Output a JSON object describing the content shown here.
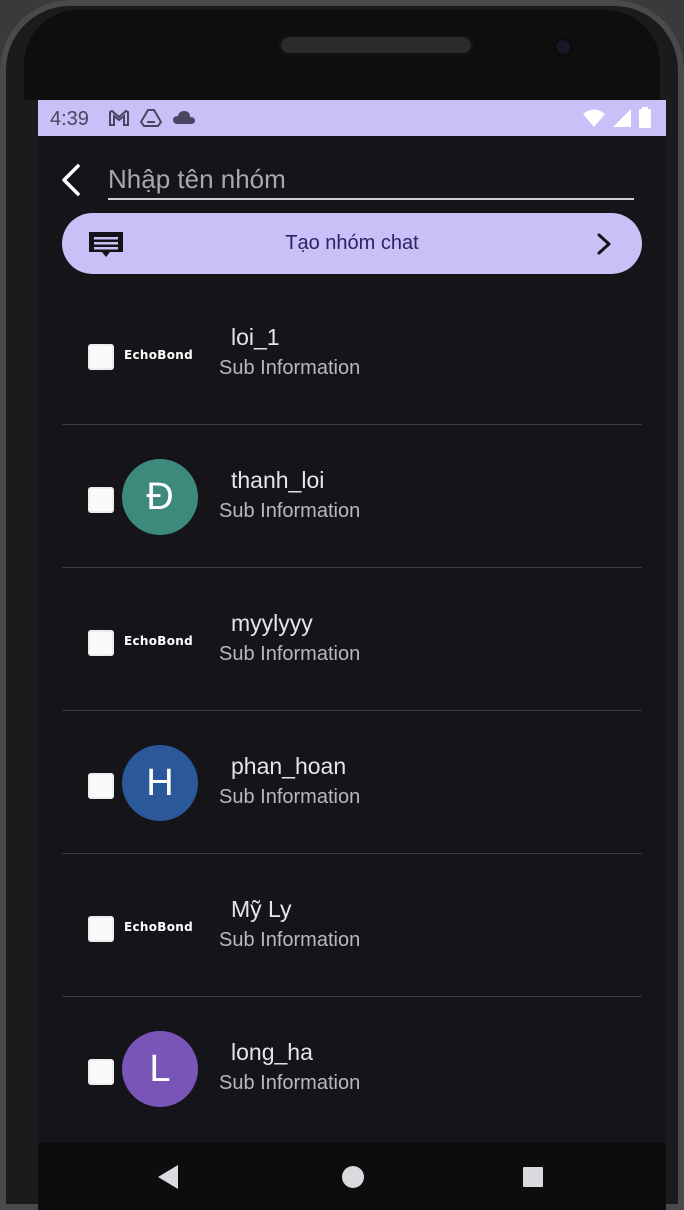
{
  "status_bar": {
    "time": "4:39",
    "left_icons": [
      "gmail-icon",
      "drive-icon",
      "cloud-icon"
    ],
    "right_icons": [
      "wifi-icon",
      "signal-icon",
      "battery-icon"
    ],
    "color": "#cbbff7"
  },
  "header": {
    "group_name_placeholder": "Nhập tên nhóm",
    "group_name_value": ""
  },
  "create_button": {
    "label": "Tạo nhóm chat"
  },
  "contacts": [
    {
      "name": "loi_1",
      "sub": "Sub Information",
      "avatar_type": "logo",
      "avatar_text": "EchoBond",
      "checked": false
    },
    {
      "name": "thanh_loi",
      "sub": "Sub Information",
      "avatar_type": "letter",
      "avatar_text": "Đ",
      "avatar_color": "#3d8a7c",
      "checked": false
    },
    {
      "name": "myylyyy",
      "sub": "Sub Information",
      "avatar_type": "logo",
      "avatar_text": "EchoBond",
      "checked": false
    },
    {
      "name": "phan_hoan",
      "sub": "Sub Information",
      "avatar_type": "letter",
      "avatar_text": "H",
      "avatar_color": "#2a5899",
      "checked": false
    },
    {
      "name": "Mỹ Ly",
      "sub": "Sub Information",
      "avatar_type": "logo",
      "avatar_text": "EchoBond",
      "checked": false
    },
    {
      "name": "long_ha",
      "sub": "Sub Information",
      "avatar_type": "letter",
      "avatar_text": "L",
      "avatar_color": "#7a55b8",
      "checked": false
    }
  ],
  "nav_bar": {
    "buttons": [
      "back-triangle-icon",
      "home-circle-icon",
      "recents-square-icon"
    ]
  }
}
